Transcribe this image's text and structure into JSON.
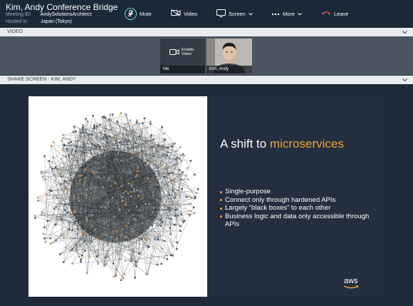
{
  "header": {
    "title": "Kim, Andy Conference Bridge",
    "meeting_id_label": "Meeting ID:",
    "meeting_id": "AndySolutionsArchitect",
    "hosted_label": "Hosted in:",
    "hosted_in": "Japan (Tokyo)"
  },
  "controls": {
    "mute": "Mute",
    "video": "Video",
    "screen": "Screen",
    "more": "More",
    "leave": "Leave"
  },
  "video_section": {
    "label": "VIDEO",
    "tiles": [
      {
        "name": "Me",
        "status": "Enable Video"
      },
      {
        "name": "Kim, Andy"
      }
    ]
  },
  "share_section": {
    "label": "SHARE SCREEN - KIM, ANDY"
  },
  "slide": {
    "title_plain": "A shift to ",
    "title_highlight": "microservices",
    "bullets": [
      "Single-purpose",
      "Connect only through hardened APIs",
      "Largely “black boxes” to each other",
      "Business logic and data only accessible through APIs"
    ],
    "logo": "aws"
  },
  "colors": {
    "accent": "#f0a33a",
    "topbar": "#1b2838",
    "leave": "#e05a4f",
    "mute_ring": "#6fd3c4"
  }
}
